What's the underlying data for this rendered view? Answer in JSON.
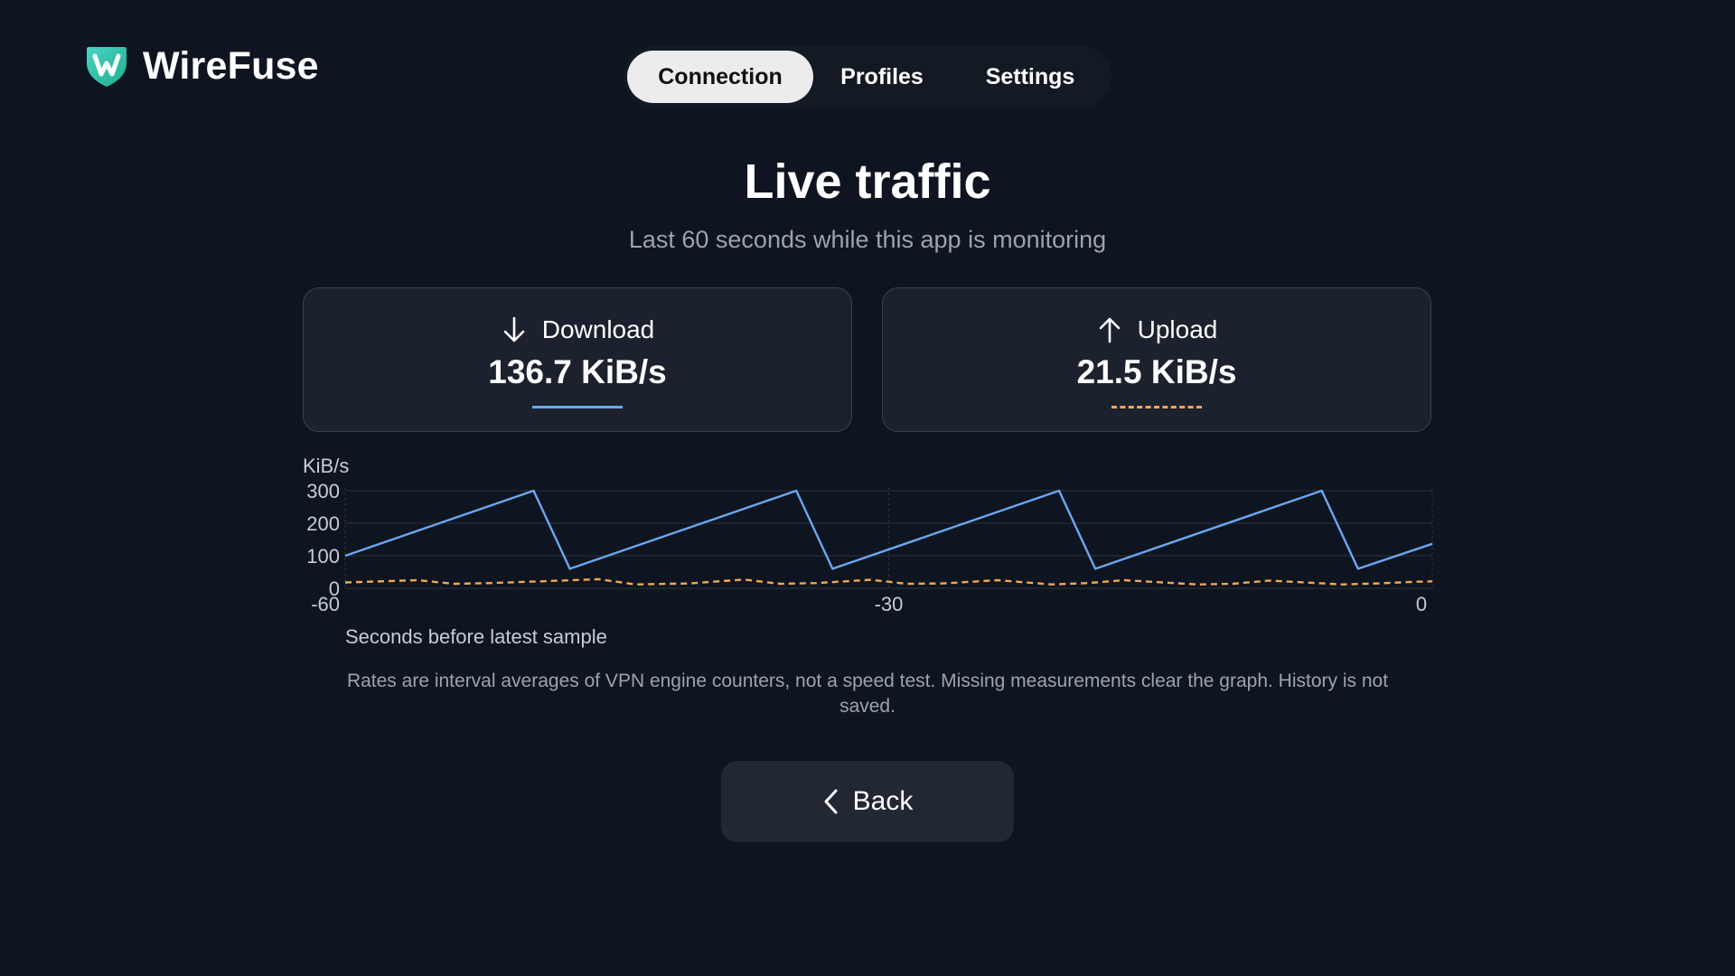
{
  "app": {
    "name": "WireFuse"
  },
  "nav": {
    "tabs": [
      {
        "label": "Connection",
        "active": true
      },
      {
        "label": "Profiles",
        "active": false
      },
      {
        "label": "Settings",
        "active": false
      }
    ]
  },
  "header": {
    "title": "Live traffic",
    "subtitle": "Last 60 seconds while this app is monitoring"
  },
  "stats": {
    "download": {
      "label": "Download",
      "value": "136.7 KiB/s",
      "icon": "arrow-down-icon",
      "color": "#6aa8f0"
    },
    "upload": {
      "label": "Upload",
      "value": "21.5 KiB/s",
      "icon": "arrow-up-icon",
      "color": "#f0a855"
    }
  },
  "chart_data": {
    "type": "line",
    "ylabel": "KiB/s",
    "xlabel": "Seconds before latest sample",
    "xlim": [
      -60,
      0
    ],
    "ylim": [
      0,
      300
    ],
    "yticks": [
      0,
      100,
      200,
      300
    ],
    "xticks": [
      -60,
      -30,
      0
    ],
    "grid": true,
    "series": [
      {
        "key": "download",
        "style": "solid",
        "color": "#6aa8f0",
        "x": [
          -60,
          -49.6,
          -47.6,
          -35.1,
          -33.1,
          -20.6,
          -18.6,
          -6.1,
          -4.1,
          0
        ],
        "y": [
          100,
          300,
          60,
          300,
          60,
          300,
          60,
          300,
          60,
          136.7
        ]
      },
      {
        "key": "upload",
        "style": "dashed",
        "color": "#f0a855",
        "x": [
          -60,
          -56,
          -54,
          -52,
          -48,
          -46,
          -44,
          -41,
          -38,
          -36,
          -34,
          -31,
          -29,
          -27,
          -24,
          -21,
          -19,
          -17,
          -13,
          -11,
          -9,
          -5,
          -3,
          -1,
          0
        ],
        "y": [
          18,
          25,
          14,
          16,
          24,
          28,
          12,
          15,
          27,
          14,
          16,
          26,
          14,
          15,
          25,
          12,
          16,
          25,
          12,
          14,
          24,
          12,
          15,
          20,
          21.5
        ]
      }
    ]
  },
  "footnote": "Rates are interval averages of VPN engine counters, not a speed test. Missing measurements clear the graph. History is not saved.",
  "actions": {
    "back_label": "Back"
  }
}
